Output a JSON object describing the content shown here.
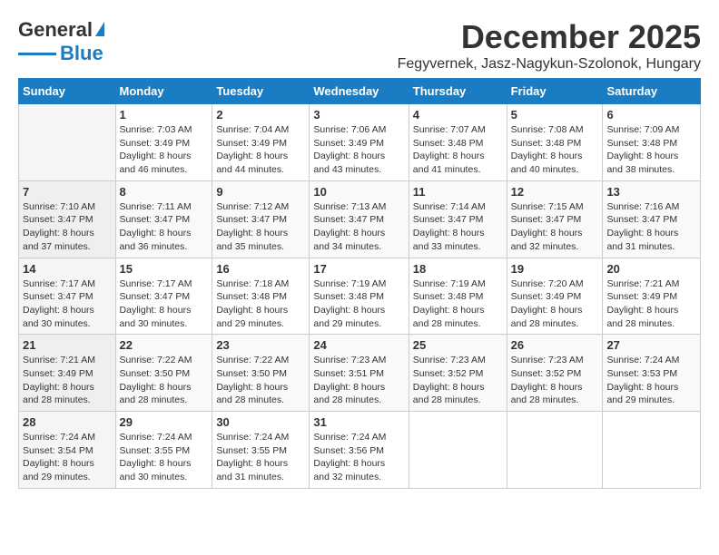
{
  "logo": {
    "line1": "General",
    "line2": "Blue"
  },
  "title": "December 2025",
  "subtitle": "Fegyvernek, Jasz-Nagykun-Szolonok, Hungary",
  "headers": [
    "Sunday",
    "Monday",
    "Tuesday",
    "Wednesday",
    "Thursday",
    "Friday",
    "Saturday"
  ],
  "weeks": [
    [
      {
        "day": "",
        "info": ""
      },
      {
        "day": "1",
        "info": "Sunrise: 7:03 AM\nSunset: 3:49 PM\nDaylight: 8 hours\nand 46 minutes."
      },
      {
        "day": "2",
        "info": "Sunrise: 7:04 AM\nSunset: 3:49 PM\nDaylight: 8 hours\nand 44 minutes."
      },
      {
        "day": "3",
        "info": "Sunrise: 7:06 AM\nSunset: 3:49 PM\nDaylight: 8 hours\nand 43 minutes."
      },
      {
        "day": "4",
        "info": "Sunrise: 7:07 AM\nSunset: 3:48 PM\nDaylight: 8 hours\nand 41 minutes."
      },
      {
        "day": "5",
        "info": "Sunrise: 7:08 AM\nSunset: 3:48 PM\nDaylight: 8 hours\nand 40 minutes."
      },
      {
        "day": "6",
        "info": "Sunrise: 7:09 AM\nSunset: 3:48 PM\nDaylight: 8 hours\nand 38 minutes."
      }
    ],
    [
      {
        "day": "7",
        "info": "Sunrise: 7:10 AM\nSunset: 3:47 PM\nDaylight: 8 hours\nand 37 minutes."
      },
      {
        "day": "8",
        "info": "Sunrise: 7:11 AM\nSunset: 3:47 PM\nDaylight: 8 hours\nand 36 minutes."
      },
      {
        "day": "9",
        "info": "Sunrise: 7:12 AM\nSunset: 3:47 PM\nDaylight: 8 hours\nand 35 minutes."
      },
      {
        "day": "10",
        "info": "Sunrise: 7:13 AM\nSunset: 3:47 PM\nDaylight: 8 hours\nand 34 minutes."
      },
      {
        "day": "11",
        "info": "Sunrise: 7:14 AM\nSunset: 3:47 PM\nDaylight: 8 hours\nand 33 minutes."
      },
      {
        "day": "12",
        "info": "Sunrise: 7:15 AM\nSunset: 3:47 PM\nDaylight: 8 hours\nand 32 minutes."
      },
      {
        "day": "13",
        "info": "Sunrise: 7:16 AM\nSunset: 3:47 PM\nDaylight: 8 hours\nand 31 minutes."
      }
    ],
    [
      {
        "day": "14",
        "info": "Sunrise: 7:17 AM\nSunset: 3:47 PM\nDaylight: 8 hours\nand 30 minutes."
      },
      {
        "day": "15",
        "info": "Sunrise: 7:17 AM\nSunset: 3:47 PM\nDaylight: 8 hours\nand 30 minutes."
      },
      {
        "day": "16",
        "info": "Sunrise: 7:18 AM\nSunset: 3:48 PM\nDaylight: 8 hours\nand 29 minutes."
      },
      {
        "day": "17",
        "info": "Sunrise: 7:19 AM\nSunset: 3:48 PM\nDaylight: 8 hours\nand 29 minutes."
      },
      {
        "day": "18",
        "info": "Sunrise: 7:19 AM\nSunset: 3:48 PM\nDaylight: 8 hours\nand 28 minutes."
      },
      {
        "day": "19",
        "info": "Sunrise: 7:20 AM\nSunset: 3:49 PM\nDaylight: 8 hours\nand 28 minutes."
      },
      {
        "day": "20",
        "info": "Sunrise: 7:21 AM\nSunset: 3:49 PM\nDaylight: 8 hours\nand 28 minutes."
      }
    ],
    [
      {
        "day": "21",
        "info": "Sunrise: 7:21 AM\nSunset: 3:49 PM\nDaylight: 8 hours\nand 28 minutes."
      },
      {
        "day": "22",
        "info": "Sunrise: 7:22 AM\nSunset: 3:50 PM\nDaylight: 8 hours\nand 28 minutes."
      },
      {
        "day": "23",
        "info": "Sunrise: 7:22 AM\nSunset: 3:50 PM\nDaylight: 8 hours\nand 28 minutes."
      },
      {
        "day": "24",
        "info": "Sunrise: 7:23 AM\nSunset: 3:51 PM\nDaylight: 8 hours\nand 28 minutes."
      },
      {
        "day": "25",
        "info": "Sunrise: 7:23 AM\nSunset: 3:52 PM\nDaylight: 8 hours\nand 28 minutes."
      },
      {
        "day": "26",
        "info": "Sunrise: 7:23 AM\nSunset: 3:52 PM\nDaylight: 8 hours\nand 28 minutes."
      },
      {
        "day": "27",
        "info": "Sunrise: 7:24 AM\nSunset: 3:53 PM\nDaylight: 8 hours\nand 29 minutes."
      }
    ],
    [
      {
        "day": "28",
        "info": "Sunrise: 7:24 AM\nSunset: 3:54 PM\nDaylight: 8 hours\nand 29 minutes."
      },
      {
        "day": "29",
        "info": "Sunrise: 7:24 AM\nSunset: 3:55 PM\nDaylight: 8 hours\nand 30 minutes."
      },
      {
        "day": "30",
        "info": "Sunrise: 7:24 AM\nSunset: 3:55 PM\nDaylight: 8 hours\nand 31 minutes."
      },
      {
        "day": "31",
        "info": "Sunrise: 7:24 AM\nSunset: 3:56 PM\nDaylight: 8 hours\nand 32 minutes."
      },
      {
        "day": "",
        "info": ""
      },
      {
        "day": "",
        "info": ""
      },
      {
        "day": "",
        "info": ""
      }
    ]
  ]
}
